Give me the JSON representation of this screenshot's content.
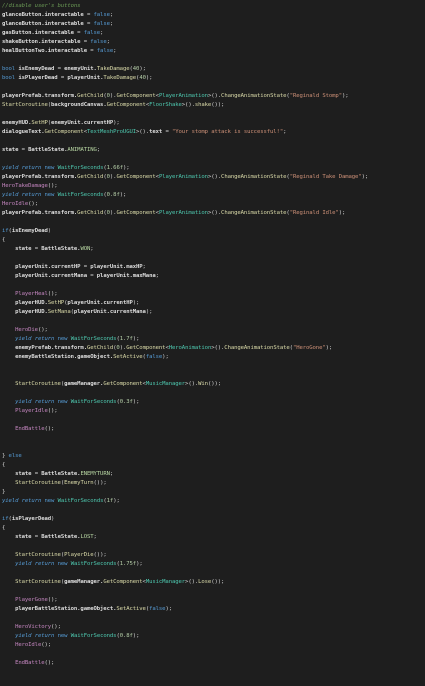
{
  "editor": {
    "background": "#1e1e1e",
    "colors": {
      "comment": "#6a9955",
      "keyword": "#569cd6",
      "type": "#4ec9b0",
      "method": "#dcdcaa",
      "string": "#ce9178",
      "number": "#b5cea8",
      "text": "#d4d4d4"
    },
    "lines": [
      [
        [
          "cm",
          "//disable user's buttons"
        ]
      ],
      [
        [
          "fd",
          "glanceButton.interactable"
        ],
        [
          "tx",
          " = "
        ],
        [
          "kw",
          "false"
        ],
        [
          "tx",
          ";"
        ]
      ],
      [
        [
          "fd",
          "glanceButton.interactable"
        ],
        [
          "tx",
          " = "
        ],
        [
          "kw",
          "false"
        ],
        [
          "tx",
          ";"
        ]
      ],
      [
        [
          "fd",
          "gasButton.interactable"
        ],
        [
          "tx",
          " = "
        ],
        [
          "kw",
          "false"
        ],
        [
          "tx",
          ";"
        ]
      ],
      [
        [
          "fd",
          "shakeButton.interactable"
        ],
        [
          "tx",
          " = "
        ],
        [
          "kw",
          "false"
        ],
        [
          "tx",
          ";"
        ]
      ],
      [
        [
          "fd",
          "healButtonTwo.interactable"
        ],
        [
          "tx",
          " = "
        ],
        [
          "kw",
          "false"
        ],
        [
          "tx",
          ";"
        ]
      ],
      [],
      [
        [
          "kw",
          "bool"
        ],
        [
          "tx",
          " "
        ],
        [
          "fd",
          "isEnemyDead"
        ],
        [
          "tx",
          " = "
        ],
        [
          "fd",
          "enemyUnit."
        ],
        [
          "mt",
          "TakeDamage"
        ],
        [
          "tx",
          "("
        ],
        [
          "nm",
          "40"
        ],
        [
          "tx",
          ");"
        ]
      ],
      [
        [
          "kw",
          "bool"
        ],
        [
          "tx",
          " "
        ],
        [
          "fd",
          "isPlayerDead"
        ],
        [
          "tx",
          " = "
        ],
        [
          "fd",
          "playerUnit."
        ],
        [
          "mt",
          "TakeDamage"
        ],
        [
          "tx",
          "("
        ],
        [
          "nm",
          "40"
        ],
        [
          "tx",
          ");"
        ]
      ],
      [],
      [
        [
          "fd",
          "playerPrefab.transform."
        ],
        [
          "mt",
          "GetChild"
        ],
        [
          "tx",
          "("
        ],
        [
          "nm",
          "0"
        ],
        [
          "tx",
          ")."
        ],
        [
          "mt",
          "GetComponent"
        ],
        [
          "tx",
          "<"
        ],
        [
          "ty",
          "PlayerAnimation"
        ],
        [
          "tx",
          ">()."
        ],
        [
          "mt",
          "ChangeAnimationState"
        ],
        [
          "tx",
          "("
        ],
        [
          "st",
          "\"Reginald Stomp\""
        ],
        [
          "tx",
          ");"
        ]
      ],
      [
        [
          "mt",
          "StartCoroutine"
        ],
        [
          "tx",
          "("
        ],
        [
          "fd",
          "backgroundCanvas."
        ],
        [
          "mt",
          "GetComponent"
        ],
        [
          "tx",
          "<"
        ],
        [
          "ty",
          "FloorShake"
        ],
        [
          "tx",
          ">()."
        ],
        [
          "mt",
          "shake"
        ],
        [
          "tx",
          "());"
        ]
      ],
      [],
      [
        [
          "fd",
          "enemyHUD."
        ],
        [
          "mt",
          "SetHP"
        ],
        [
          "tx",
          "("
        ],
        [
          "fd",
          "enemyUnit.currentHP"
        ],
        [
          "tx",
          ");"
        ]
      ],
      [
        [
          "fd",
          "dialogueText."
        ],
        [
          "mt",
          "GetComponent"
        ],
        [
          "tx",
          "<"
        ],
        [
          "ty",
          "TextMeshProUGUI"
        ],
        [
          "tx",
          ">()."
        ],
        [
          "fd",
          "text"
        ],
        [
          "tx",
          " = "
        ],
        [
          "st",
          "\"Your stomp attack is successful!\""
        ],
        [
          "tx",
          ";"
        ]
      ],
      [],
      [
        [
          "fd",
          "state"
        ],
        [
          "tx",
          " = "
        ],
        [
          "fd",
          "BattleState."
        ],
        [
          "en",
          "ANIMATING"
        ],
        [
          "tx",
          ";"
        ]
      ],
      [],
      [
        [
          "kwi",
          "yield"
        ],
        [
          "tx",
          " "
        ],
        [
          "kwi",
          "return"
        ],
        [
          "tx",
          " "
        ],
        [
          "kw",
          "new"
        ],
        [
          "tx",
          " "
        ],
        [
          "ty",
          "WaitForSeconds"
        ],
        [
          "tx",
          "("
        ],
        [
          "nm",
          "1.66f"
        ],
        [
          "tx",
          ");"
        ]
      ],
      [
        [
          "fd",
          "playerPrefab.transform."
        ],
        [
          "mt",
          "GetChild"
        ],
        [
          "tx",
          "("
        ],
        [
          "nm",
          "0"
        ],
        [
          "tx",
          ")."
        ],
        [
          "mt",
          "GetComponent"
        ],
        [
          "tx",
          "<"
        ],
        [
          "ty",
          "PlayerAnimation"
        ],
        [
          "tx",
          ">()."
        ],
        [
          "mt",
          "ChangeAnimationState"
        ],
        [
          "tx",
          "("
        ],
        [
          "st",
          "\"Reginald Take Damage\""
        ],
        [
          "tx",
          ");"
        ]
      ],
      [
        [
          "mt2",
          "HeroTakeDamage"
        ],
        [
          "tx",
          "();"
        ]
      ],
      [
        [
          "kwi",
          "yield"
        ],
        [
          "tx",
          " "
        ],
        [
          "kwi",
          "return"
        ],
        [
          "tx",
          " "
        ],
        [
          "kw",
          "new"
        ],
        [
          "tx",
          " "
        ],
        [
          "ty",
          "WaitForSeconds"
        ],
        [
          "tx",
          "("
        ],
        [
          "nm",
          "0.8f"
        ],
        [
          "tx",
          ");"
        ]
      ],
      [
        [
          "mt2",
          "HeroIdle"
        ],
        [
          "tx",
          "();"
        ]
      ],
      [
        [
          "fd",
          "playerPrefab.transform."
        ],
        [
          "mt",
          "GetChild"
        ],
        [
          "tx",
          "("
        ],
        [
          "nm",
          "0"
        ],
        [
          "tx",
          ")."
        ],
        [
          "mt",
          "GetComponent"
        ],
        [
          "tx",
          "<"
        ],
        [
          "ty",
          "PlayerAnimation"
        ],
        [
          "tx",
          ">()."
        ],
        [
          "mt",
          "ChangeAnimationState"
        ],
        [
          "tx",
          "("
        ],
        [
          "st",
          "\"Reginald Idle\""
        ],
        [
          "tx",
          ");"
        ]
      ],
      [],
      [
        [
          "kw",
          "if"
        ],
        [
          "tx",
          "("
        ],
        [
          "fd",
          "isEnemyDead"
        ],
        [
          "tx",
          ")"
        ]
      ],
      [
        [
          "tx",
          "{"
        ]
      ],
      [
        [
          "tx",
          "    "
        ],
        [
          "fd",
          "state"
        ],
        [
          "tx",
          " = "
        ],
        [
          "fd",
          "BattleState."
        ],
        [
          "en",
          "WON"
        ],
        [
          "tx",
          ";"
        ]
      ],
      [],
      [
        [
          "tx",
          "    "
        ],
        [
          "fd",
          "playerUnit.currentHP"
        ],
        [
          "tx",
          " = "
        ],
        [
          "fd",
          "playerUnit.maxHP"
        ],
        [
          "tx",
          ";"
        ]
      ],
      [
        [
          "tx",
          "    "
        ],
        [
          "fd",
          "playerUnit.currentMana"
        ],
        [
          "tx",
          " = "
        ],
        [
          "fd",
          "playerUnit.maxMana"
        ],
        [
          "tx",
          ";"
        ]
      ],
      [],
      [
        [
          "tx",
          "    "
        ],
        [
          "mt2",
          "PlayerHeal"
        ],
        [
          "tx",
          "();"
        ]
      ],
      [
        [
          "tx",
          "    "
        ],
        [
          "fd",
          "playerHUD."
        ],
        [
          "mt",
          "SetHP"
        ],
        [
          "tx",
          "("
        ],
        [
          "fd",
          "playerUnit.currentHP"
        ],
        [
          "tx",
          ");"
        ]
      ],
      [
        [
          "tx",
          "    "
        ],
        [
          "fd",
          "playerHUD."
        ],
        [
          "mt",
          "SetMana"
        ],
        [
          "tx",
          "("
        ],
        [
          "fd",
          "playerUnit.currentMana"
        ],
        [
          "tx",
          ");"
        ]
      ],
      [],
      [
        [
          "tx",
          "    "
        ],
        [
          "mt2",
          "HeroDie"
        ],
        [
          "tx",
          "();"
        ]
      ],
      [
        [
          "tx",
          "    "
        ],
        [
          "kwi",
          "yield"
        ],
        [
          "tx",
          " "
        ],
        [
          "kwi",
          "return"
        ],
        [
          "tx",
          " "
        ],
        [
          "kw",
          "new"
        ],
        [
          "tx",
          " "
        ],
        [
          "ty",
          "WaitForSeconds"
        ],
        [
          "tx",
          "("
        ],
        [
          "nm",
          "1.7f"
        ],
        [
          "tx",
          ");"
        ]
      ],
      [
        [
          "tx",
          "    "
        ],
        [
          "fd",
          "enemyPrefab.transform."
        ],
        [
          "mt",
          "GetChild"
        ],
        [
          "tx",
          "("
        ],
        [
          "nm",
          "0"
        ],
        [
          "tx",
          ")."
        ],
        [
          "mt",
          "GetComponent"
        ],
        [
          "tx",
          "<"
        ],
        [
          "ty",
          "HeroAnimation"
        ],
        [
          "tx",
          ">()."
        ],
        [
          "mt",
          "ChangeAnimationState"
        ],
        [
          "tx",
          "("
        ],
        [
          "st",
          "\"HeroGone\""
        ],
        [
          "tx",
          ");"
        ]
      ],
      [
        [
          "tx",
          "    "
        ],
        [
          "fd",
          "enemyBattleStation.gameObject."
        ],
        [
          "mt",
          "SetActive"
        ],
        [
          "tx",
          "("
        ],
        [
          "kw",
          "false"
        ],
        [
          "tx",
          ");"
        ]
      ],
      [],
      [],
      [
        [
          "tx",
          "    "
        ],
        [
          "mt",
          "StartCoroutine"
        ],
        [
          "tx",
          "("
        ],
        [
          "fd",
          "gameManager."
        ],
        [
          "mt",
          "GetComponent"
        ],
        [
          "tx",
          "<"
        ],
        [
          "ty",
          "MusicManager"
        ],
        [
          "tx",
          ">()."
        ],
        [
          "mt",
          "Win"
        ],
        [
          "tx",
          "());"
        ]
      ],
      [],
      [
        [
          "tx",
          "    "
        ],
        [
          "kwi",
          "yield"
        ],
        [
          "tx",
          " "
        ],
        [
          "kwi",
          "return"
        ],
        [
          "tx",
          " "
        ],
        [
          "kw",
          "new"
        ],
        [
          "tx",
          " "
        ],
        [
          "ty",
          "WaitForSeconds"
        ],
        [
          "tx",
          "("
        ],
        [
          "nm",
          "0.3f"
        ],
        [
          "tx",
          ");"
        ]
      ],
      [
        [
          "tx",
          "    "
        ],
        [
          "mt2",
          "PlayerIdle"
        ],
        [
          "tx",
          "();"
        ]
      ],
      [],
      [
        [
          "tx",
          "    "
        ],
        [
          "mt2",
          "EndBattle"
        ],
        [
          "tx",
          "();"
        ]
      ],
      [],
      [],
      [
        [
          "tx",
          "} "
        ],
        [
          "kw",
          "else"
        ]
      ],
      [
        [
          "tx",
          "{"
        ]
      ],
      [
        [
          "tx",
          "    "
        ],
        [
          "fd",
          "state"
        ],
        [
          "tx",
          " = "
        ],
        [
          "fd",
          "BattleState."
        ],
        [
          "en",
          "ENEMYTURN"
        ],
        [
          "tx",
          ";"
        ]
      ],
      [
        [
          "tx",
          "    "
        ],
        [
          "mt",
          "StartCoroutine"
        ],
        [
          "tx",
          "("
        ],
        [
          "mt",
          "EnemyTurn"
        ],
        [
          "tx",
          "());"
        ]
      ],
      [
        [
          "tx",
          "}"
        ]
      ],
      [
        [
          "kwi",
          "yield"
        ],
        [
          "tx",
          " "
        ],
        [
          "kwi",
          "return"
        ],
        [
          "tx",
          " "
        ],
        [
          "kw",
          "new"
        ],
        [
          "tx",
          " "
        ],
        [
          "ty",
          "WaitForSeconds"
        ],
        [
          "tx",
          "("
        ],
        [
          "nm",
          "1f"
        ],
        [
          "tx",
          ");"
        ]
      ],
      [],
      [
        [
          "kw",
          "if"
        ],
        [
          "tx",
          "("
        ],
        [
          "fd",
          "isPlayerDead"
        ],
        [
          "tx",
          ")"
        ]
      ],
      [
        [
          "tx",
          "{"
        ]
      ],
      [
        [
          "tx",
          "    "
        ],
        [
          "fd",
          "state"
        ],
        [
          "tx",
          " = "
        ],
        [
          "fd",
          "BattleState."
        ],
        [
          "en",
          "LOST"
        ],
        [
          "tx",
          ";"
        ]
      ],
      [],
      [
        [
          "tx",
          "    "
        ],
        [
          "mt",
          "StartCoroutine"
        ],
        [
          "tx",
          "("
        ],
        [
          "mt",
          "PlayerDie"
        ],
        [
          "tx",
          "());"
        ]
      ],
      [
        [
          "tx",
          "    "
        ],
        [
          "kwi",
          "yield"
        ],
        [
          "tx",
          " "
        ],
        [
          "kwi",
          "return"
        ],
        [
          "tx",
          " "
        ],
        [
          "kw",
          "new"
        ],
        [
          "tx",
          " "
        ],
        [
          "ty",
          "WaitForSeconds"
        ],
        [
          "tx",
          "("
        ],
        [
          "nm",
          "1.75f"
        ],
        [
          "tx",
          ");"
        ]
      ],
      [],
      [
        [
          "tx",
          "    "
        ],
        [
          "mt",
          "StartCoroutine"
        ],
        [
          "tx",
          "("
        ],
        [
          "fd",
          "gameManager."
        ],
        [
          "mt",
          "GetComponent"
        ],
        [
          "tx",
          "<"
        ],
        [
          "ty",
          "MusicManager"
        ],
        [
          "tx",
          ">()."
        ],
        [
          "mt",
          "Lose"
        ],
        [
          "tx",
          "());"
        ]
      ],
      [],
      [
        [
          "tx",
          "    "
        ],
        [
          "mt2",
          "PlayerGone"
        ],
        [
          "tx",
          "();"
        ]
      ],
      [
        [
          "tx",
          "    "
        ],
        [
          "fd",
          "playerBattleStation.gameObject."
        ],
        [
          "mt",
          "SetActive"
        ],
        [
          "tx",
          "("
        ],
        [
          "kw",
          "false"
        ],
        [
          "tx",
          ");"
        ]
      ],
      [],
      [
        [
          "tx",
          "    "
        ],
        [
          "mt2",
          "HeroVictory"
        ],
        [
          "tx",
          "();"
        ]
      ],
      [
        [
          "tx",
          "    "
        ],
        [
          "kwi",
          "yield"
        ],
        [
          "tx",
          " "
        ],
        [
          "kwi",
          "return"
        ],
        [
          "tx",
          " "
        ],
        [
          "kw",
          "new"
        ],
        [
          "tx",
          " "
        ],
        [
          "ty",
          "WaitForSeconds"
        ],
        [
          "tx",
          "("
        ],
        [
          "nm",
          "0.8f"
        ],
        [
          "tx",
          ");"
        ]
      ],
      [
        [
          "tx",
          "    "
        ],
        [
          "mt2",
          "HeroIdle"
        ],
        [
          "tx",
          "();"
        ]
      ],
      [],
      [
        [
          "tx",
          "    "
        ],
        [
          "mt2",
          "EndBattle"
        ],
        [
          "tx",
          "();"
        ]
      ]
    ]
  }
}
